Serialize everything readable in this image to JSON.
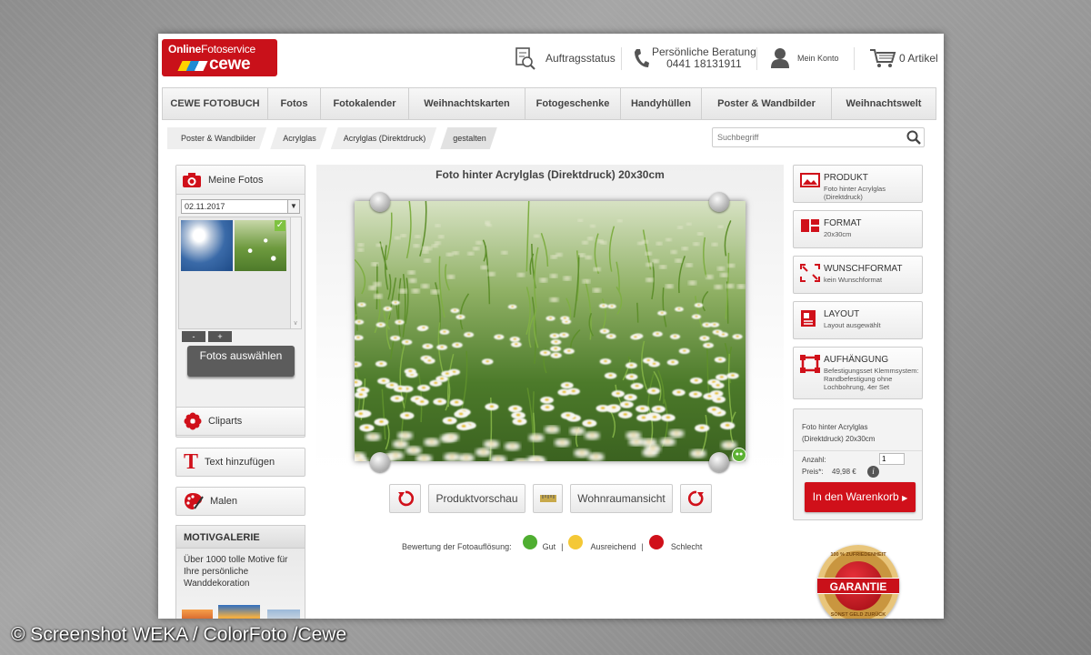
{
  "logo": {
    "line1a": "Online",
    "line1b": "Fotoservice",
    "line2": "cewe"
  },
  "header": {
    "order_status": "Auftragsstatus",
    "consult_title": "Persönliche Beratung",
    "consult_phone": "0441 18131911",
    "account": "Mein Konto",
    "cart": "0 Artikel"
  },
  "nav": [
    "CEWE FOTOBUCH",
    "Fotos",
    "Fotokalender",
    "Weihnachtskarten",
    "Fotogeschenke",
    "Handyhüllen",
    "Poster & Wandbilder",
    "Weihnachtswelt"
  ],
  "breadcrumb": [
    "Poster & Wandbilder",
    "Acrylglas",
    "Acrylglas (Direktdruck)",
    "gestalten"
  ],
  "search": {
    "placeholder": "Suchbegriff"
  },
  "left": {
    "my_photos": "Meine Fotos",
    "date": "02.11.2017",
    "minus": "-",
    "plus": "+",
    "select_btn": "Fotos auswählen",
    "cliparts": "Cliparts",
    "add_text": "Text hinzufügen",
    "paint": "Malen",
    "motiv_title": "MOTIVGALERIE",
    "motiv_text": "Über 1000 tolle Motive für Ihre persönliche Wanddekoration"
  },
  "center": {
    "title": "Foto hinter Acrylglas (Direktdruck) 20x30cm",
    "preview_btn": "Produktvorschau",
    "room_btn": "Wohnraumansicht"
  },
  "rating": {
    "label": "Bewertung der Fotoauflösung:",
    "good": "Gut",
    "ok": "Ausreichend",
    "bad": "Schlecht",
    "sep": "|"
  },
  "right": {
    "product_t": "PRODUKT",
    "product_v": "Foto hinter Acrylglas (Direktdruck)",
    "format_t": "FORMAT",
    "format_v": "20x30cm",
    "wunsch_t": "WUNSCHFORMAT",
    "wunsch_v": "kein Wunschformat",
    "layout_t": "LAYOUT",
    "layout_v": "Layout ausgewählt",
    "hang_t": "AUFHÄNGUNG",
    "hang_v": "Befestigungsset Klemmsystem: Randbefestigung ohne Lochbohrung, 4er Set"
  },
  "cart": {
    "desc": "Foto hinter Acrylglas (Direktdruck) 20x30cm",
    "qty_label": "Anzahl:",
    "qty": "1",
    "price_label": "Preis*:",
    "price": "49,98 €",
    "info": "i",
    "btn": "In den Warenkorb"
  },
  "badge": {
    "main": "GARANTIE",
    "top": "100 % ZUFRIEDENHEIT",
    "bottom": "SONST GELD ZURÜCK"
  },
  "credit": "© Screenshot WEKA / ColorFoto /Cewe",
  "colors": {
    "brand_red": "#c9111a",
    "button_red": "#d0101a",
    "nav_bg": "#ececec"
  }
}
